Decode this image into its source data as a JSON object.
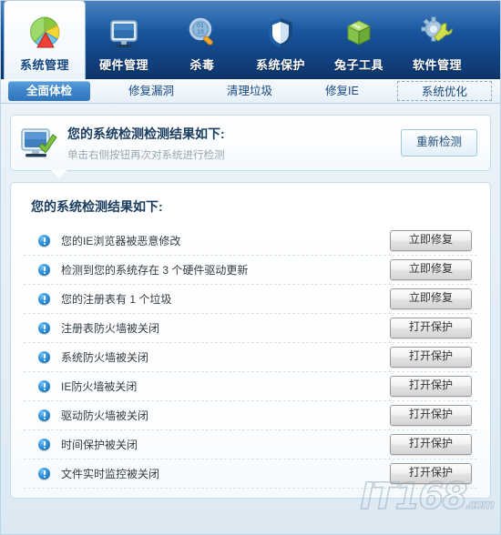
{
  "topnav": {
    "items": [
      {
        "label": "系统管理",
        "icon": "pie-chart-icon",
        "active": true
      },
      {
        "label": "硬件管理",
        "icon": "monitor-icon",
        "active": false
      },
      {
        "label": "杀毒",
        "icon": "magnifier-icon",
        "active": false
      },
      {
        "label": "系统保护",
        "icon": "shield-icon",
        "active": false
      },
      {
        "label": "兔子工具",
        "icon": "green-box-icon",
        "active": false
      },
      {
        "label": "软件管理",
        "icon": "gear-wrench-icon",
        "active": false
      }
    ]
  },
  "subtabs": {
    "items": [
      {
        "label": "全面体检",
        "state": "selected"
      },
      {
        "label": "修复漏洞",
        "state": "normal"
      },
      {
        "label": "清理垃圾",
        "state": "normal"
      },
      {
        "label": "修复IE",
        "state": "normal"
      },
      {
        "label": "系统优化",
        "state": "focused"
      }
    ]
  },
  "summary": {
    "icon": "monitor-check-icon",
    "title": "您的系统检测检测结果如下:",
    "subtitle": "单击右侧按钮再次对系统进行检测",
    "rescan_label": "重新检测"
  },
  "results": {
    "title": "您的系统检测结果如下:",
    "rows": [
      {
        "text": "您的IE浏览器被恶意修改",
        "action": "立即修复"
      },
      {
        "text": "检测到您的系统存在 3 个硬件驱动更新",
        "action": "立即修复"
      },
      {
        "text": "您的注册表有 1 个垃圾",
        "action": "立即修复"
      },
      {
        "text": "注册表防火墙被关闭",
        "action": "打开保护"
      },
      {
        "text": "系统防火墙被关闭",
        "action": "打开保护"
      },
      {
        "text": "IE防火墙被关闭",
        "action": "打开保护"
      },
      {
        "text": "驱动防火墙被关闭",
        "action": "打开保护"
      },
      {
        "text": "时间保护被关闭",
        "action": "打开保护"
      },
      {
        "text": "文件实时监控被关闭",
        "action": "打开保护"
      }
    ]
  },
  "watermark": {
    "text": "IT168",
    "suffix": ".com"
  },
  "colors": {
    "nav_blue": "#1b5aa4",
    "tab_selected": "#3d84c9",
    "panel_border": "#c3dced",
    "warn_icon": "#2a8fd8",
    "title_text": "#1a3c5e"
  }
}
